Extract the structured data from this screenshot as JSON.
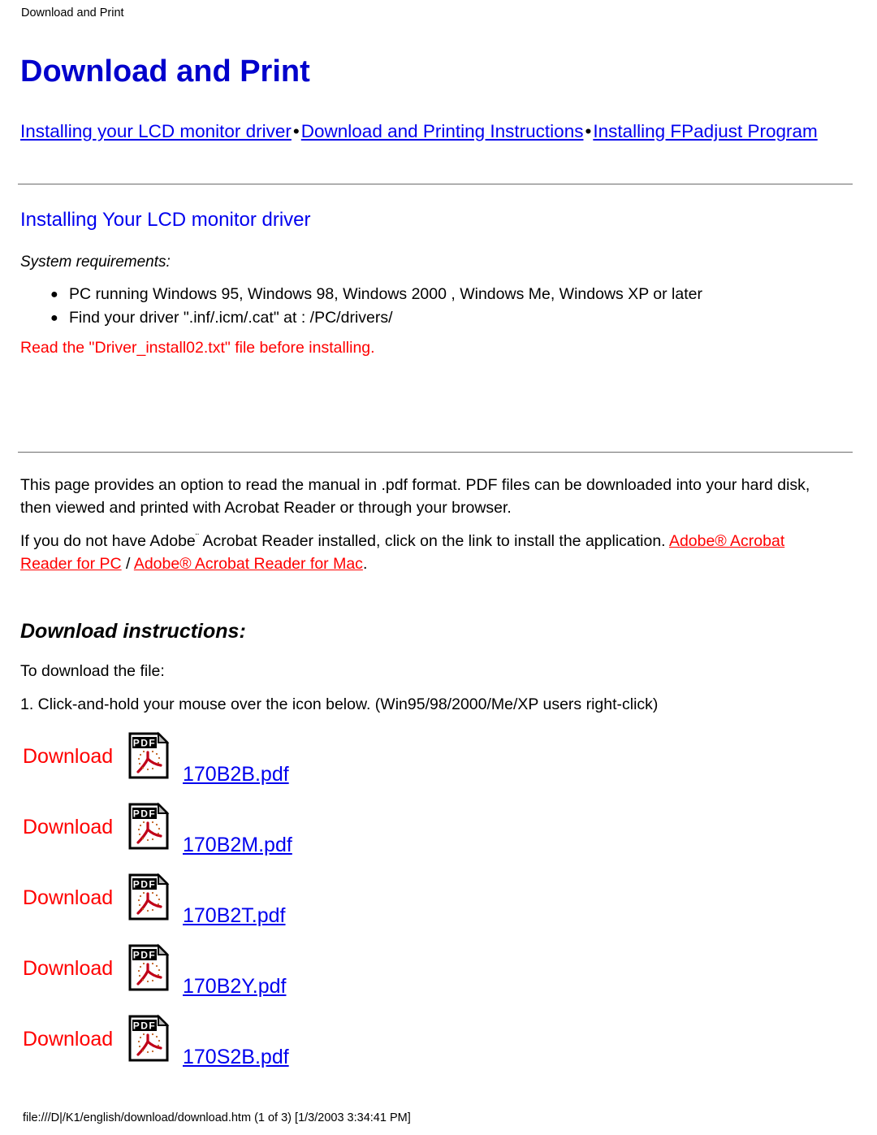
{
  "breadcrumb": "Download and Print",
  "title": "Download and Print",
  "nav": {
    "links": [
      "Installing your LCD monitor driver",
      "Download and Printing Instructions",
      "Installing FPadjust Program"
    ],
    "separator": "•"
  },
  "section": {
    "heading": "Installing Your LCD monitor driver",
    "system_requirements_label": "System requirements:",
    "requirements": [
      "PC running Windows 95, Windows 98, Windows 2000 , Windows Me, Windows XP or later",
      "Find your driver \".inf/.icm/.cat\" at : /PC/drivers/"
    ],
    "bullet_glyph": "●",
    "warning": "Read the \"Driver_install02.txt\" file before installing."
  },
  "intro": {
    "paragraph1": "This page provides an option to read the manual in .pdf format. PDF files can be downloaded into your hard disk, then viewed and printed with Acrobat Reader or through your browser.",
    "paragraph2_pre": "If you do not have Adobe",
    "paragraph2_tm": "¨",
    "paragraph2_mid": " Acrobat Reader installed, click on the link to install the application. ",
    "link_pc": "Adobe® Acrobat Reader for PC",
    "link_divider": " / ",
    "link_mac": "Adobe® Acrobat Reader for Mac",
    "paragraph2_end": "."
  },
  "download": {
    "heading": "Download instructions:",
    "note": "To download the file:",
    "step1": "1. Click-and-hold your mouse over the icon below. (Win95/98/2000/Me/XP users right-click)",
    "rows": [
      {
        "label": "Download",
        "icon": "pdf-file-icon",
        "file": "170B2B.pdf"
      },
      {
        "label": "Download",
        "icon": "pdf-file-icon",
        "file": "170B2M.pdf"
      },
      {
        "label": "Download",
        "icon": "pdf-file-icon",
        "file": "170B2T.pdf"
      },
      {
        "label": "Download",
        "icon": "pdf-file-icon",
        "file": "170B2Y.pdf"
      },
      {
        "label": "Download",
        "icon": "pdf-file-icon",
        "file": "170S2B.pdf"
      }
    ]
  },
  "footer": "file:///D|/K1/english/download/download.htm (1 of 3) [1/3/2003 3:34:41 PM]",
  "colors": {
    "title_blue": "#0000CC",
    "link_blue": "#0000EE",
    "link_red": "#FF0000",
    "text_black": "#000000",
    "pdf_icon_red": "#C00018"
  }
}
